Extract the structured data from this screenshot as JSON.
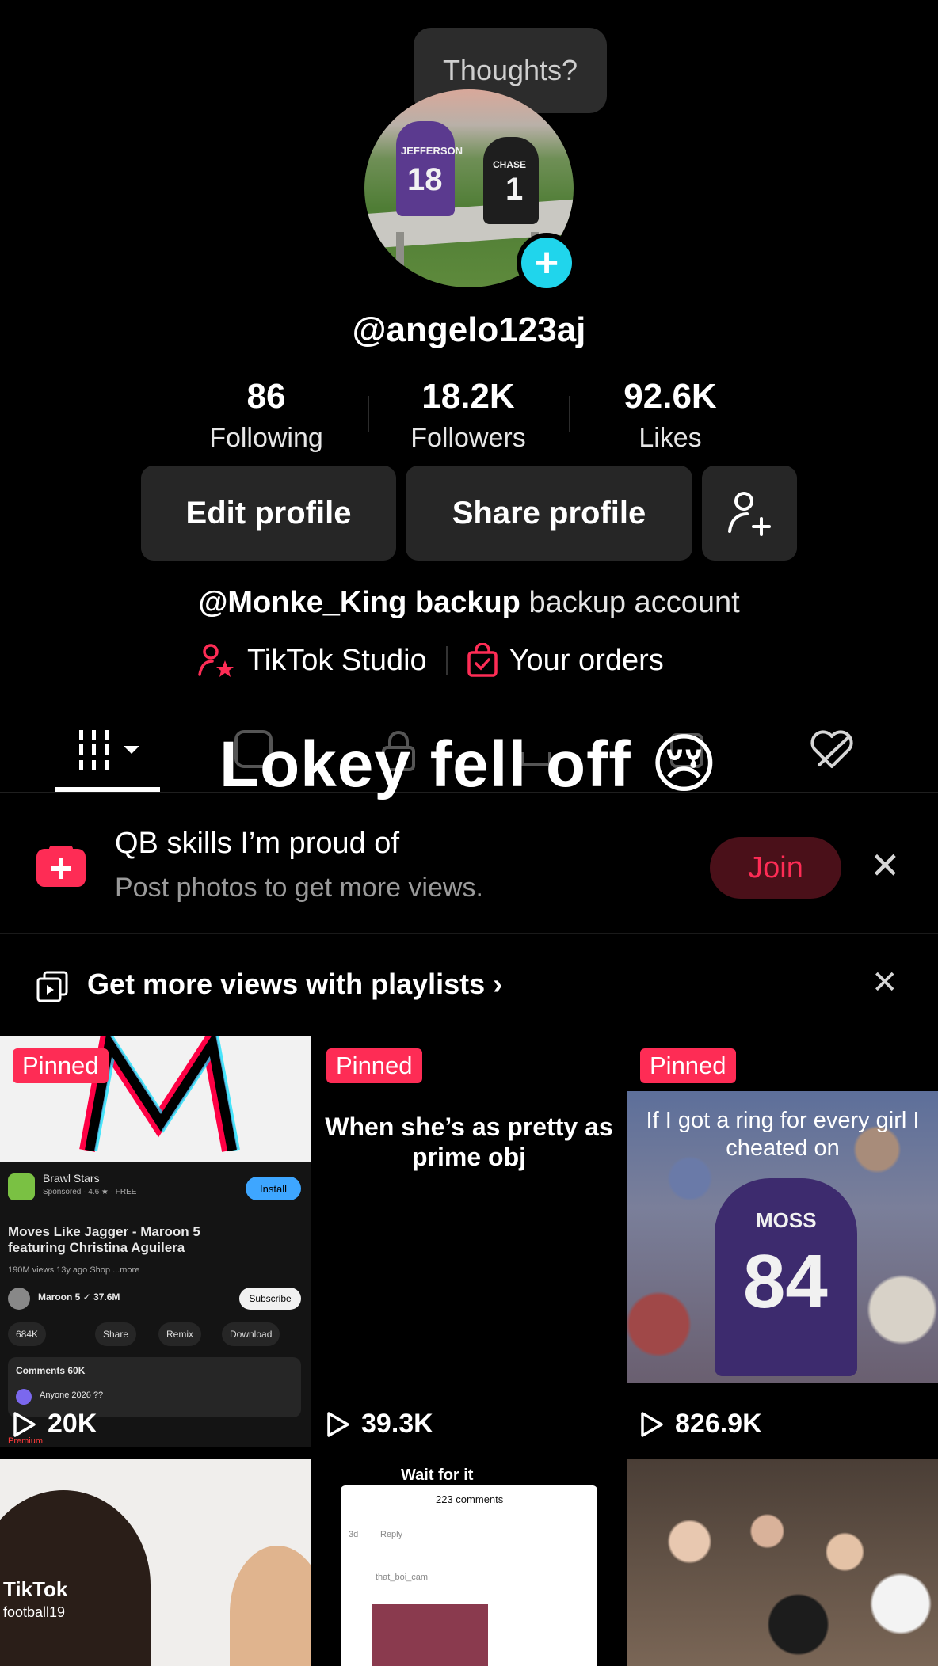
{
  "profile": {
    "bubble_text": "Thoughts?",
    "username": "@angelo123aj",
    "avatar_jersey_left": {
      "name": "JEFFERSON",
      "number": "18"
    },
    "avatar_jersey_right": {
      "name": "CHASE",
      "number": "1"
    },
    "plus": "+"
  },
  "stats": [
    {
      "value": "86",
      "label": "Following"
    },
    {
      "value": "18.2K",
      "label": "Followers"
    },
    {
      "value": "92.6K",
      "label": "Likes"
    }
  ],
  "buttons": {
    "edit": "Edit profile",
    "share": "Share profile"
  },
  "bio": {
    "bold": "@Monke_King backup",
    "rest": " backup account"
  },
  "links": {
    "studio": "TikTok Studio",
    "orders": "Your orders"
  },
  "overlay_text": "Lokey fell off",
  "overlay_emoji": "😢",
  "join_banner": {
    "title": "QB skills I’m proud of",
    "subtitle": "Post photos to get more views.",
    "button": "Join",
    "close": "✕"
  },
  "playlist_banner": {
    "text": "Get more views with playlists",
    "chevron": "›",
    "close": "✕"
  },
  "grid": {
    "pinned_label": "Pinned",
    "videos": [
      {
        "views": "20K",
        "caption": ""
      },
      {
        "views": "39.3K",
        "caption": "When she’s as pretty as prime obj"
      },
      {
        "views": "826.9K",
        "caption": "If I got a ring for every girl I cheated on"
      }
    ],
    "cell1": {
      "app": "Brawl Stars",
      "sponsored": "Sponsored · 4.6 ★ · FREE",
      "install": "Install",
      "title": "Moves Like Jagger - Maroon 5 featuring Christina Aguilera",
      "meta": "190M views  13y ago  Shop  ...more",
      "channel": "Maroon 5 ✓  37.6M",
      "subscribe": "Subscribe",
      "likes": "684K",
      "share": "Share",
      "remix": "Remix",
      "download": "Download",
      "comments": "Comments 60K",
      "comment": "Anyone 2026 ??",
      "premium": "Premium"
    },
    "cell3_jersey": {
      "name": "MOSS",
      "number": "84"
    },
    "row2": {
      "tiktok_watermark": "TikTok",
      "tiktok_user": "football19",
      "wait_text": "Wait for it",
      "comments_count": "223 comments",
      "comment_user": "that_boi_cam",
      "reply": "Reply",
      "reply_time": "3d"
    }
  },
  "colors": {
    "accent": "#fe2c55",
    "plus_badge": "#20d5ec",
    "button_bg": "#262626"
  }
}
